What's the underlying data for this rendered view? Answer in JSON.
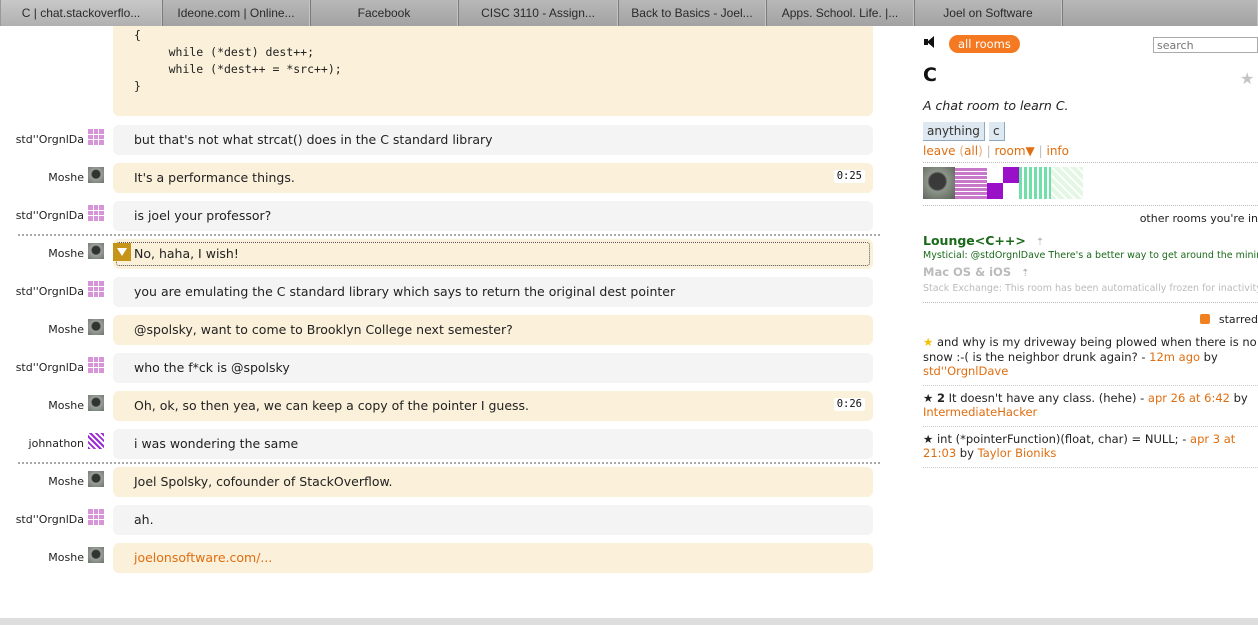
{
  "browser_tabs": [
    {
      "label": "C | chat.stackoverflo...",
      "active": true
    },
    {
      "label": "Ideone.com | Online...",
      "active": false
    },
    {
      "label": "Facebook",
      "active": false
    },
    {
      "label": "CISC 3110 - Assign...",
      "active": false
    },
    {
      "label": "Back to Basics - Joel...",
      "active": false
    },
    {
      "label": "Apps. School. Life. |...",
      "active": false
    },
    {
      "label": "Joel on Software",
      "active": false
    }
  ],
  "code_message": {
    "lines": "{\n     while (*dest) dest++;\n     while (*dest++ = *src++);\n}"
  },
  "messages": [
    {
      "user": "std''OrgnlDa",
      "avatar": "orgnl",
      "text": "but that's not what strcat() does in the C standard library",
      "style": "other"
    },
    {
      "user": "Moshe",
      "avatar": "moshe",
      "text": "It's a performance things.",
      "style": "mine",
      "timestamp": "0:25"
    },
    {
      "user": "std''OrgnlDa",
      "avatar": "orgnl",
      "text": "is joel your professor?",
      "style": "other"
    },
    {
      "user": "Moshe",
      "avatar": "moshe",
      "text": "No, haha, I wish!",
      "style": "mine",
      "highlighted": true
    },
    {
      "user": "std''OrgnlDa",
      "avatar": "orgnl",
      "text": "you are emulating the C standard library which says to return the original dest pointer",
      "style": "other"
    },
    {
      "user": "Moshe",
      "avatar": "moshe",
      "text": "@spolsky, want to come to Brooklyn College next semester?",
      "style": "mine"
    },
    {
      "user": "std''OrgnlDa",
      "avatar": "orgnl",
      "text": "who the f*ck is @spolsky",
      "style": "other"
    },
    {
      "user": "Moshe",
      "avatar": "moshe",
      "text": "Oh, ok, so then yea, we can keep a copy of the pointer I guess.",
      "style": "mine",
      "timestamp": "0:26"
    },
    {
      "user": "johnathon",
      "avatar": "john",
      "text": "i was wondering the same",
      "style": "other"
    },
    {
      "user": "Moshe",
      "avatar": "moshe",
      "text": "Joel Spolsky, cofounder of StackOverflow.",
      "style": "mine"
    },
    {
      "user": "std''OrgnlDa",
      "avatar": "orgnl",
      "text": "ah.",
      "style": "other"
    },
    {
      "user": "Moshe",
      "avatar": "moshe",
      "text": "joelonsoftware.com/...",
      "style": "mine",
      "is_link": true
    }
  ],
  "sidebar": {
    "all_rooms_label": "all rooms",
    "search_placeholder": "search",
    "room_title": "C",
    "room_description": "A chat room to learn C.",
    "tags": [
      "anything",
      "c"
    ],
    "links": {
      "leave": "leave",
      "all": "all",
      "room": "room",
      "info": "info"
    },
    "other_rooms_label": "other rooms you're in",
    "other_rooms": [
      {
        "name": "Lounge<C++>",
        "last_message": "Mysticial: @stdOrgnlDave There's a better way to get around the minimum",
        "active": true
      },
      {
        "name": "Mac OS & iOS",
        "last_message": "Stack Exchange: This room has been automatically frozen for inactivity",
        "active": false
      }
    ],
    "starred_label": "starred",
    "starred": [
      {
        "stars": "",
        "gold": true,
        "text": "and why is my driveway being plowed when there is no snow :-( is the neighbor drunk again? - ",
        "time": "12m ago",
        "by": " by ",
        "user": "std''OrgnlDave"
      },
      {
        "stars": "2",
        "gold": false,
        "text": "It doesn't have any class. (hehe) - ",
        "time": "apr 26 at 6:42",
        "by": " by ",
        "user": "IntermediateHacker"
      },
      {
        "stars": "",
        "gold": false,
        "text": "int (*pointerFunction)(float, char) = NULL; - ",
        "time": "apr 3 at 21:03",
        "by": " by ",
        "user": "Taylor Bioniks"
      }
    ]
  },
  "colors": {
    "accent": "#f47920",
    "link": "#e06e10",
    "mine_bubble": "#fbf0da",
    "other_bubble": "#f4f4f4"
  }
}
